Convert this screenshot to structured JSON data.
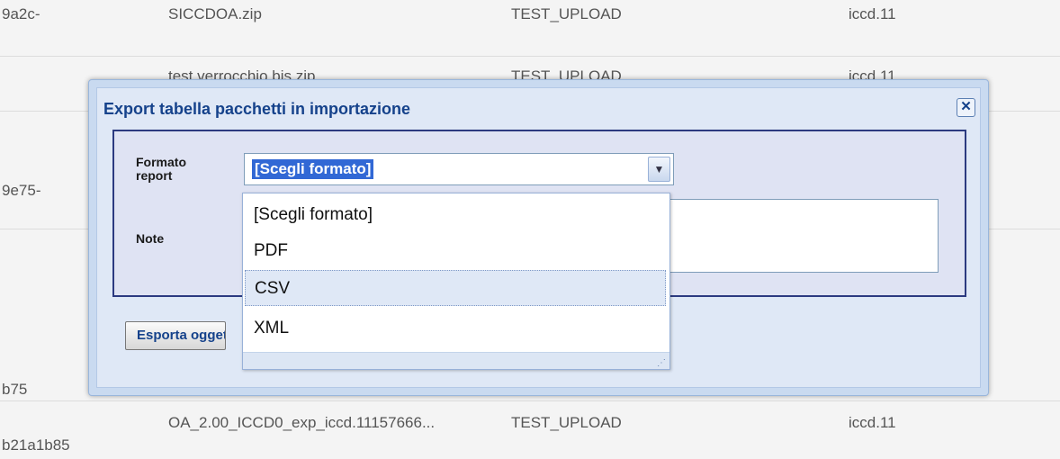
{
  "background": {
    "rows": [
      {
        "id": "9a2c-",
        "file": "SICCDOA.zip",
        "action": "TEST_UPLOAD",
        "version": "iccd.11"
      },
      {
        "id": "",
        "file": "test verrocchio bis zip",
        "action": "TEST_UPLOAD",
        "version": "iccd.11"
      },
      {
        "id": "9e75-",
        "file": "",
        "action": "",
        "version": ""
      },
      {
        "id": "b75",
        "file": "",
        "action": "",
        "version": ""
      },
      {
        "id": "b21a1b85",
        "file": "OA_2.00_ICCD0_exp_iccd.11157666...",
        "action": "TEST_UPLOAD",
        "version": "iccd.11"
      }
    ]
  },
  "dialog": {
    "title": "Export tabella pacchetti in importazione",
    "close_symbol": "✕",
    "format_label": "Formato report",
    "note_label": "Note",
    "selected_format": "[Scegli formato]",
    "export_button": "Esporta oggetti"
  },
  "dropdown": {
    "options": [
      "[Scegli formato]",
      "PDF",
      "CSV",
      "XML"
    ],
    "highlighted": "CSV"
  },
  "icons": {
    "close": "close-icon",
    "select_arrow": "chevron-down-icon",
    "resize": "resize-grip-icon"
  },
  "colors": {
    "dialog_title": "#15428b",
    "selection": "#3168d5",
    "panel_border": "#2c3a80"
  }
}
